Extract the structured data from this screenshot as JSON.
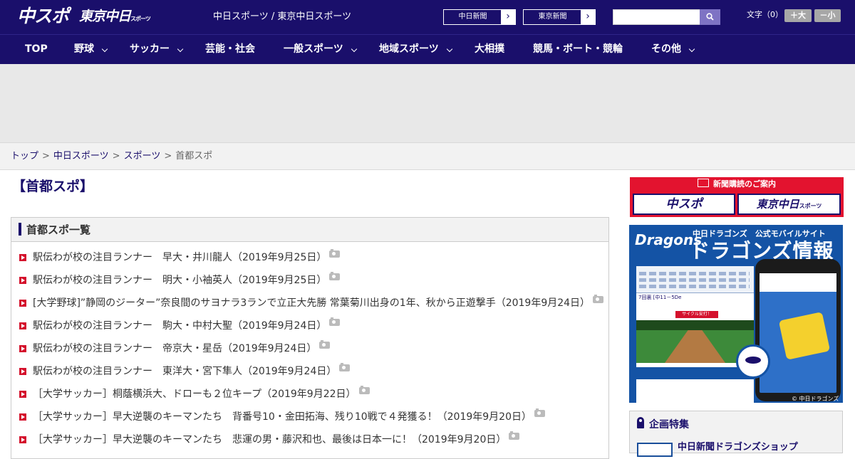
{
  "header": {
    "logo_chusupo": "中スポ",
    "logo_tokyo": "東京中日",
    "logo_tokyo_suffix": "スポーツ",
    "site_name": "中日スポーツ / 東京中日スポーツ",
    "link_chunichi": "中日新聞",
    "link_tokyo": "東京新聞",
    "search_placeholder": "",
    "font_label": "文字（0）",
    "font_big": "＋大",
    "font_small": "－小"
  },
  "nav": {
    "items": [
      "TOP",
      "野球",
      "サッカー",
      "芸能・社会",
      "一般スポーツ",
      "地域スポーツ",
      "大相撲",
      "競馬・ボート・競輪",
      "その他"
    ]
  },
  "breadcrumb": {
    "items": [
      "トップ",
      "中日スポーツ",
      "スポーツ"
    ],
    "current": "首都スポ",
    "separator": ">"
  },
  "page_title": "【首都スポ】",
  "list": {
    "heading": "首都スポ一覧",
    "items": [
      "駅伝わが校の注目ランナー　早大・井川龍人（2019年9月25日）",
      "駅伝わが校の注目ランナー　明大・小袖英人（2019年9月25日）",
      "[大学野球]”静岡のジーター”奈良間のサヨナラ3ランで立正大先勝 常葉菊川出身の1年、秋から正遊撃手（2019年9月24日）",
      "駅伝わが校の注目ランナー　駒大・中村大聖（2019年9月24日）",
      "駅伝わが校の注目ランナー　帝京大・星岳（2019年9月24日）",
      "駅伝わが校の注目ランナー　東洋大・宮下隼人（2019年9月24日）",
      "［大学サッカー］桐蔭横浜大、ドローも２位キープ（2019年9月22日）",
      "［大学サッカー］早大逆襲のキーマンたち　背番号10・金田拓海、残り10戦で４発獲る！（2019年9月20日）",
      "［大学サッカー］早大逆襲のキーマンたち　悲運の男・藤沢和也、最後は日本一に！（2019年9月20日）"
    ]
  },
  "sidebar": {
    "subscribe_head": "新聞購読のご案内",
    "subscribe_left": "中スポ",
    "subscribe_right": "東京中日",
    "subscribe_right_suffix": "スポーツ",
    "dragons_logo": "Dragons",
    "dragons_sub": "中日ドラゴンズ　公式モバイルサイト",
    "dragons_title": "ドラゴンズ情報",
    "dragons_status": "7回裏 [中11－5De",
    "dragons_cycle": "サイクル安打！",
    "dragons_copy": "© 中日ドラゴンズ",
    "kikaku_title": "企画特集",
    "kikaku_item": "中日新聞ドラゴンズショップ"
  },
  "colors": {
    "brand_navy": "#1a0f6b",
    "accent_red": "#d4102c",
    "dragons_blue": "#1453a5"
  }
}
